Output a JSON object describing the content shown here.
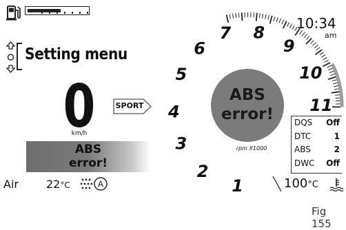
{
  "fuel": {
    "level": 0.55
  },
  "menu": {
    "title": "Setting menu"
  },
  "speed": {
    "value": "0",
    "unit": "km/h"
  },
  "riding_mode": {
    "label": "SPORT"
  },
  "abs_banner": {
    "line1": "ABS",
    "line2": "error!"
  },
  "air": {
    "label": "Air",
    "temp": "22",
    "unit": "°C"
  },
  "mode_icon": {
    "letter": "A"
  },
  "tach": {
    "numbers": [
      "1",
      "2",
      "3",
      "4",
      "5",
      "6",
      "7",
      "8",
      "9",
      "10",
      "11"
    ],
    "unit_label": "rpm X1000",
    "center_line1": "ABS",
    "center_line2": "error!"
  },
  "clock": {
    "time": "10:34",
    "ampm": "am"
  },
  "status": [
    {
      "key": "DQS",
      "value": "Off"
    },
    {
      "key": "DTC",
      "value": "1"
    },
    {
      "key": "ABS",
      "value": "2"
    },
    {
      "key": "DWC",
      "value": "Off"
    }
  ],
  "water": {
    "temp": "100",
    "unit": "°C"
  },
  "figure": {
    "label": "Fig 155"
  },
  "colors": {
    "center_circle": "#7b7b7b",
    "redline": "#9e9e9e",
    "banner": "#6e6e6e"
  },
  "icons": [
    "fuel-pump-icon",
    "menu-arrows-icon",
    "traction-mode-icon",
    "coolant-temperature-icon"
  ]
}
